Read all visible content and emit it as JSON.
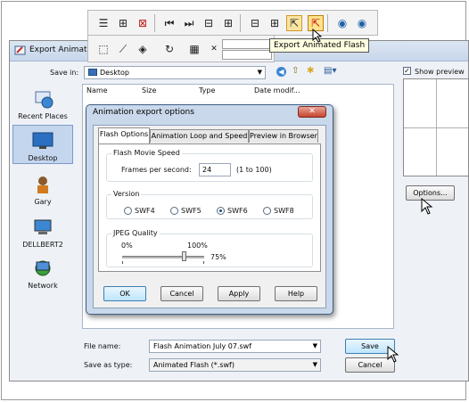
{
  "toolbar": {
    "tooltip": "Export Animated Flash",
    "icons": [
      "frames-icon",
      "frame-add-icon",
      "frame-delete-icon",
      "first-frame-icon",
      "last-frame-icon",
      "frame-props-icon",
      "frame-options-icon",
      "layer-props-icon",
      "layer-options-icon",
      "export-flash-icon",
      "export-animated-flash-icon",
      "globe-export-icon",
      "globe-stop-icon"
    ]
  },
  "export_dialog": {
    "title": "Export Animated",
    "save_in_label": "Save in:",
    "save_in_value": "Desktop",
    "places": [
      {
        "label": "Recent Places",
        "icon": "recent-places-icon"
      },
      {
        "label": "Desktop",
        "icon": "desktop-icon"
      },
      {
        "label": "Gary",
        "icon": "user-icon"
      },
      {
        "label": "DELLBERT2",
        "icon": "computer-icon"
      },
      {
        "label": "Network",
        "icon": "network-icon"
      }
    ],
    "columns": [
      "Name",
      "Size",
      "Type",
      "Date modif..."
    ],
    "show_preview_label": "Show preview",
    "options_button": "Options...",
    "file_name_label": "File name:",
    "file_name_value": "Flash Animation July 07.swf",
    "save_as_type_label": "Save as type:",
    "save_as_type_value": "Animated Flash (*.swf)",
    "save_button": "Save",
    "cancel_button": "Cancel"
  },
  "anim_dialog": {
    "title": "Animation export options",
    "tabs": [
      "Flash Options",
      "Animation Loop and Speed",
      "Preview in Browser"
    ],
    "speed_group": "Flash Movie Speed",
    "fps_label": "Frames per second:",
    "fps_value": "24",
    "fps_range": "(1 to 100)",
    "version_group": "Version",
    "versions": [
      "SWF4",
      "SWF5",
      "SWF6",
      "SWF8"
    ],
    "selected_version": "SWF6",
    "jpeg_group": "JPEG Quality",
    "jpeg_min": "0%",
    "jpeg_max": "100%",
    "jpeg_value": "75%",
    "jpeg_quality_fraction": 0.75,
    "ok": "OK",
    "cancel": "Cancel",
    "apply": "Apply",
    "help": "Help"
  }
}
